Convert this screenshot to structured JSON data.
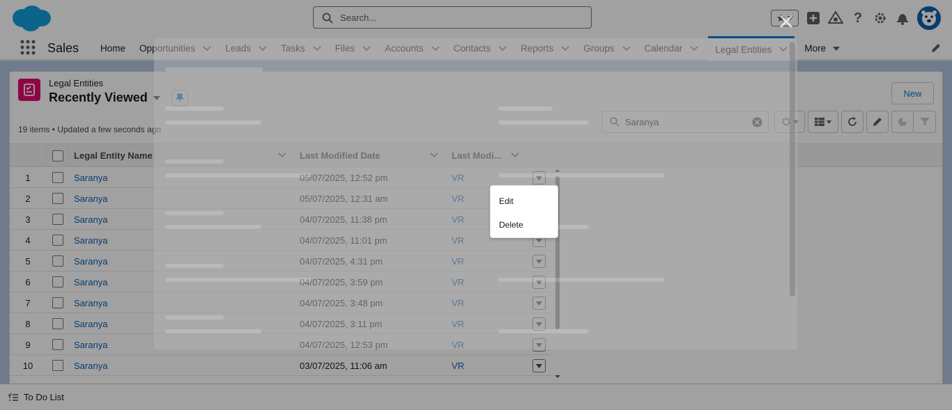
{
  "header": {
    "search_placeholder": "Search...",
    "icons": [
      "favorites-star-icon",
      "favorites-menu-chevron-icon",
      "global-actions-plus-icon",
      "trailhead-icon",
      "help-icon",
      "setup-gear-icon",
      "notifications-bell-icon",
      "user-avatar"
    ]
  },
  "nav": {
    "app_name": "Sales",
    "items": [
      {
        "label": "Home",
        "has_menu": false
      },
      {
        "label": "Opportunities",
        "has_menu": true
      },
      {
        "label": "Leads",
        "has_menu": true
      },
      {
        "label": "Tasks",
        "has_menu": true
      },
      {
        "label": "Files",
        "has_menu": true
      },
      {
        "label": "Accounts",
        "has_menu": true
      },
      {
        "label": "Contacts",
        "has_menu": true
      },
      {
        "label": "Reports",
        "has_menu": true
      },
      {
        "label": "Groups",
        "has_menu": true
      },
      {
        "label": "Calendar",
        "has_menu": true
      },
      {
        "label": "Legal Entities",
        "has_menu": true,
        "active": true
      }
    ],
    "more_label": "More"
  },
  "list_view": {
    "object_label": "Legal Entities",
    "view_name": "Recently Viewed",
    "new_label": "New",
    "meta": "19 items • Updated a few seconds ago",
    "search_value": "Saranya",
    "columns": [
      "Legal Entity Name",
      "Last Modified Date",
      "Last Modi..."
    ],
    "rows": [
      {
        "num": "1",
        "name": "Saranya",
        "date": "05/07/2025, 12:52 pm",
        "by": "VR"
      },
      {
        "num": "2",
        "name": "Saranya",
        "date": "05/07/2025, 12:31 am",
        "by": "VR"
      },
      {
        "num": "3",
        "name": "Saranya",
        "date": "04/07/2025, 11:38 pm",
        "by": "VR"
      },
      {
        "num": "4",
        "name": "Saranya",
        "date": "04/07/2025, 11:01 pm",
        "by": "VR"
      },
      {
        "num": "5",
        "name": "Saranya",
        "date": "04/07/2025, 4:31 pm",
        "by": "VR"
      },
      {
        "num": "6",
        "name": "Saranya",
        "date": "04/07/2025, 3:59 pm",
        "by": "VR"
      },
      {
        "num": "7",
        "name": "Saranya",
        "date": "04/07/2025, 3:48 pm",
        "by": "VR"
      },
      {
        "num": "8",
        "name": "Saranya",
        "date": "04/07/2025, 3:11 pm",
        "by": "VR"
      },
      {
        "num": "9",
        "name": "Saranya",
        "date": "04/07/2025, 12:53 pm",
        "by": "VR"
      },
      {
        "num": "10",
        "name": "Saranya",
        "date": "03/07/2025, 11:06 am",
        "by": "VR"
      }
    ]
  },
  "row_menu": {
    "edit_label": "Edit",
    "delete_label": "Delete"
  },
  "utility_bar": {
    "todo_label": "To Do List"
  },
  "colors": {
    "brand_blue": "#0176d3",
    "link_blue": "#0b5cab",
    "object_icon": "#e3066a",
    "header_band": "#b0c4df"
  }
}
